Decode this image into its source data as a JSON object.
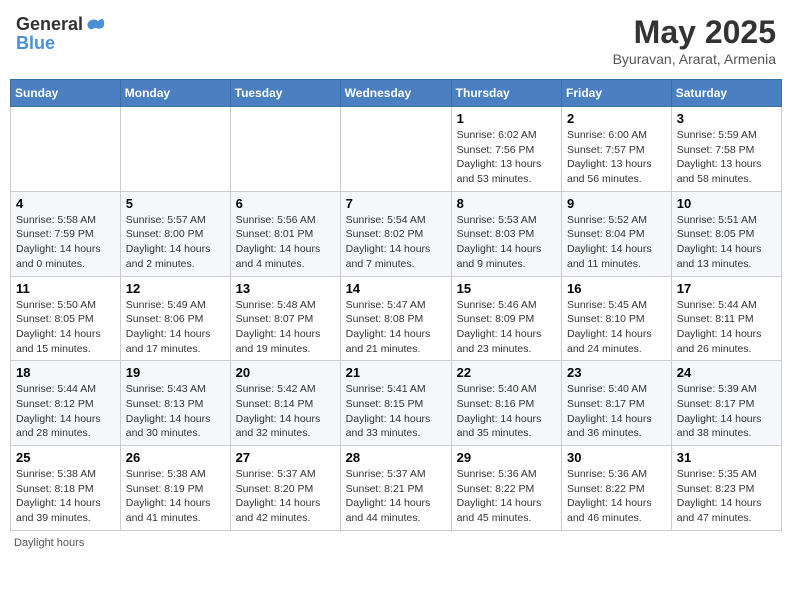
{
  "header": {
    "logo_general": "General",
    "logo_blue": "Blue",
    "month": "May 2025",
    "location": "Byuravan, Ararat, Armenia"
  },
  "weekdays": [
    "Sunday",
    "Monday",
    "Tuesday",
    "Wednesday",
    "Thursday",
    "Friday",
    "Saturday"
  ],
  "weeks": [
    [
      {
        "day": "",
        "info": ""
      },
      {
        "day": "",
        "info": ""
      },
      {
        "day": "",
        "info": ""
      },
      {
        "day": "",
        "info": ""
      },
      {
        "day": "1",
        "info": "Sunrise: 6:02 AM\nSunset: 7:56 PM\nDaylight: 13 hours\nand 53 minutes."
      },
      {
        "day": "2",
        "info": "Sunrise: 6:00 AM\nSunset: 7:57 PM\nDaylight: 13 hours\nand 56 minutes."
      },
      {
        "day": "3",
        "info": "Sunrise: 5:59 AM\nSunset: 7:58 PM\nDaylight: 13 hours\nand 58 minutes."
      }
    ],
    [
      {
        "day": "4",
        "info": "Sunrise: 5:58 AM\nSunset: 7:59 PM\nDaylight: 14 hours\nand 0 minutes."
      },
      {
        "day": "5",
        "info": "Sunrise: 5:57 AM\nSunset: 8:00 PM\nDaylight: 14 hours\nand 2 minutes."
      },
      {
        "day": "6",
        "info": "Sunrise: 5:56 AM\nSunset: 8:01 PM\nDaylight: 14 hours\nand 4 minutes."
      },
      {
        "day": "7",
        "info": "Sunrise: 5:54 AM\nSunset: 8:02 PM\nDaylight: 14 hours\nand 7 minutes."
      },
      {
        "day": "8",
        "info": "Sunrise: 5:53 AM\nSunset: 8:03 PM\nDaylight: 14 hours\nand 9 minutes."
      },
      {
        "day": "9",
        "info": "Sunrise: 5:52 AM\nSunset: 8:04 PM\nDaylight: 14 hours\nand 11 minutes."
      },
      {
        "day": "10",
        "info": "Sunrise: 5:51 AM\nSunset: 8:05 PM\nDaylight: 14 hours\nand 13 minutes."
      }
    ],
    [
      {
        "day": "11",
        "info": "Sunrise: 5:50 AM\nSunset: 8:05 PM\nDaylight: 14 hours\nand 15 minutes."
      },
      {
        "day": "12",
        "info": "Sunrise: 5:49 AM\nSunset: 8:06 PM\nDaylight: 14 hours\nand 17 minutes."
      },
      {
        "day": "13",
        "info": "Sunrise: 5:48 AM\nSunset: 8:07 PM\nDaylight: 14 hours\nand 19 minutes."
      },
      {
        "day": "14",
        "info": "Sunrise: 5:47 AM\nSunset: 8:08 PM\nDaylight: 14 hours\nand 21 minutes."
      },
      {
        "day": "15",
        "info": "Sunrise: 5:46 AM\nSunset: 8:09 PM\nDaylight: 14 hours\nand 23 minutes."
      },
      {
        "day": "16",
        "info": "Sunrise: 5:45 AM\nSunset: 8:10 PM\nDaylight: 14 hours\nand 24 minutes."
      },
      {
        "day": "17",
        "info": "Sunrise: 5:44 AM\nSunset: 8:11 PM\nDaylight: 14 hours\nand 26 minutes."
      }
    ],
    [
      {
        "day": "18",
        "info": "Sunrise: 5:44 AM\nSunset: 8:12 PM\nDaylight: 14 hours\nand 28 minutes."
      },
      {
        "day": "19",
        "info": "Sunrise: 5:43 AM\nSunset: 8:13 PM\nDaylight: 14 hours\nand 30 minutes."
      },
      {
        "day": "20",
        "info": "Sunrise: 5:42 AM\nSunset: 8:14 PM\nDaylight: 14 hours\nand 32 minutes."
      },
      {
        "day": "21",
        "info": "Sunrise: 5:41 AM\nSunset: 8:15 PM\nDaylight: 14 hours\nand 33 minutes."
      },
      {
        "day": "22",
        "info": "Sunrise: 5:40 AM\nSunset: 8:16 PM\nDaylight: 14 hours\nand 35 minutes."
      },
      {
        "day": "23",
        "info": "Sunrise: 5:40 AM\nSunset: 8:17 PM\nDaylight: 14 hours\nand 36 minutes."
      },
      {
        "day": "24",
        "info": "Sunrise: 5:39 AM\nSunset: 8:17 PM\nDaylight: 14 hours\nand 38 minutes."
      }
    ],
    [
      {
        "day": "25",
        "info": "Sunrise: 5:38 AM\nSunset: 8:18 PM\nDaylight: 14 hours\nand 39 minutes."
      },
      {
        "day": "26",
        "info": "Sunrise: 5:38 AM\nSunset: 8:19 PM\nDaylight: 14 hours\nand 41 minutes."
      },
      {
        "day": "27",
        "info": "Sunrise: 5:37 AM\nSunset: 8:20 PM\nDaylight: 14 hours\nand 42 minutes."
      },
      {
        "day": "28",
        "info": "Sunrise: 5:37 AM\nSunset: 8:21 PM\nDaylight: 14 hours\nand 44 minutes."
      },
      {
        "day": "29",
        "info": "Sunrise: 5:36 AM\nSunset: 8:22 PM\nDaylight: 14 hours\nand 45 minutes."
      },
      {
        "day": "30",
        "info": "Sunrise: 5:36 AM\nSunset: 8:22 PM\nDaylight: 14 hours\nand 46 minutes."
      },
      {
        "day": "31",
        "info": "Sunrise: 5:35 AM\nSunset: 8:23 PM\nDaylight: 14 hours\nand 47 minutes."
      }
    ]
  ],
  "footer": {
    "daylight_label": "Daylight hours"
  }
}
